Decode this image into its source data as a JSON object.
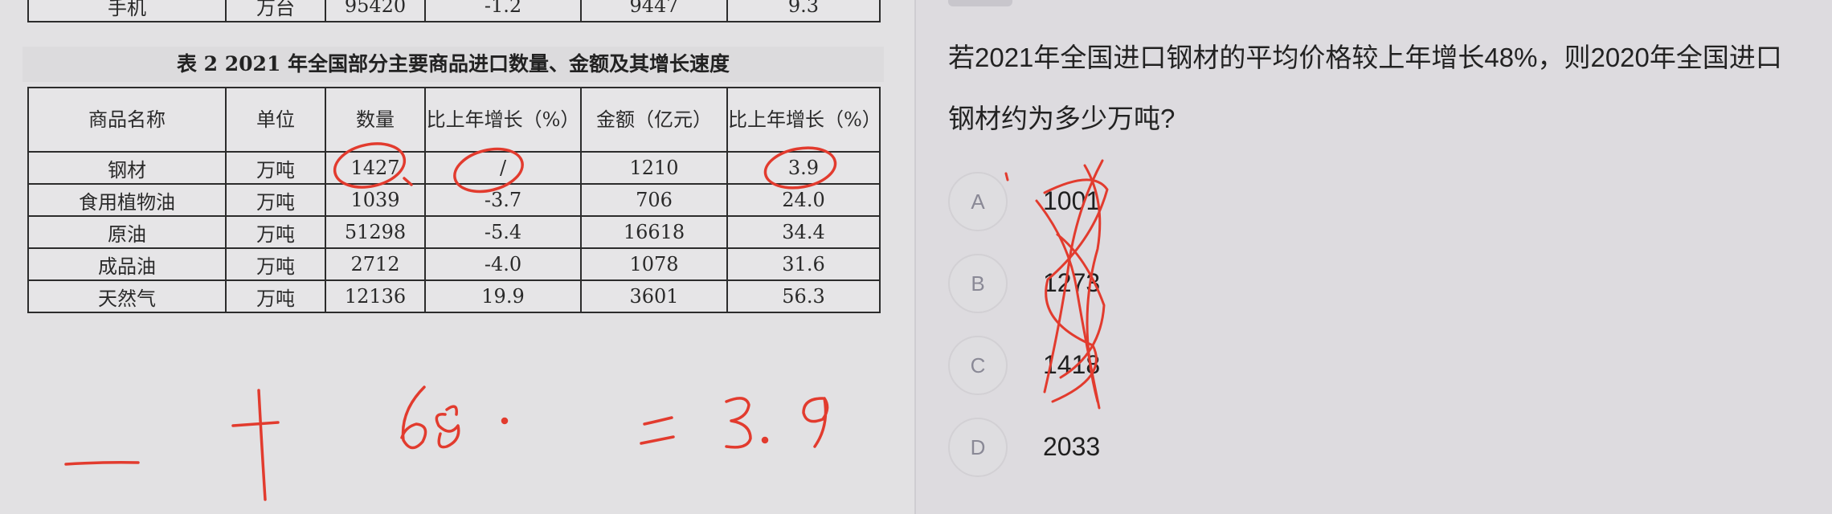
{
  "top_table": {
    "row": [
      "手机",
      "万台",
      "95420",
      "-1.2",
      "9447",
      "9.3"
    ]
  },
  "table2": {
    "caption": "表 2 2021 年全国部分主要商品进口数量、金额及其增长速度",
    "headers": [
      "商品名称",
      "单位",
      "数量",
      "比上年增长（%）",
      "金额（亿元）",
      "比上年增长（%）"
    ],
    "rows": [
      [
        "钢材",
        "万吨",
        "1427",
        "/",
        "1210",
        "3.9"
      ],
      [
        "食用植物油",
        "万吨",
        "1039",
        "-3.7",
        "706",
        "24.0"
      ],
      [
        "原油",
        "万吨",
        "51298",
        "-5.4",
        "16618",
        "34.4"
      ],
      [
        "成品油",
        "万吨",
        "2712",
        "-4.0",
        "1078",
        "31.6"
      ],
      [
        "天然气",
        "万吨",
        "12136",
        "19.9",
        "3601",
        "56.3"
      ]
    ]
  },
  "annotations": {
    "ink_color": "#e23b2e",
    "formula": [
      "一",
      "十",
      "48",
      "·",
      "二",
      "3.9"
    ]
  },
  "question": {
    "text": "若2021年全国进口钢材的平均价格较上年增长48%，则2020年全国进口钢材约为多少万吨?"
  },
  "options": [
    {
      "letter": "A",
      "value": "1001"
    },
    {
      "letter": "B",
      "value": "1273"
    },
    {
      "letter": "C",
      "value": "1418"
    },
    {
      "letter": "D",
      "value": "2033"
    }
  ]
}
